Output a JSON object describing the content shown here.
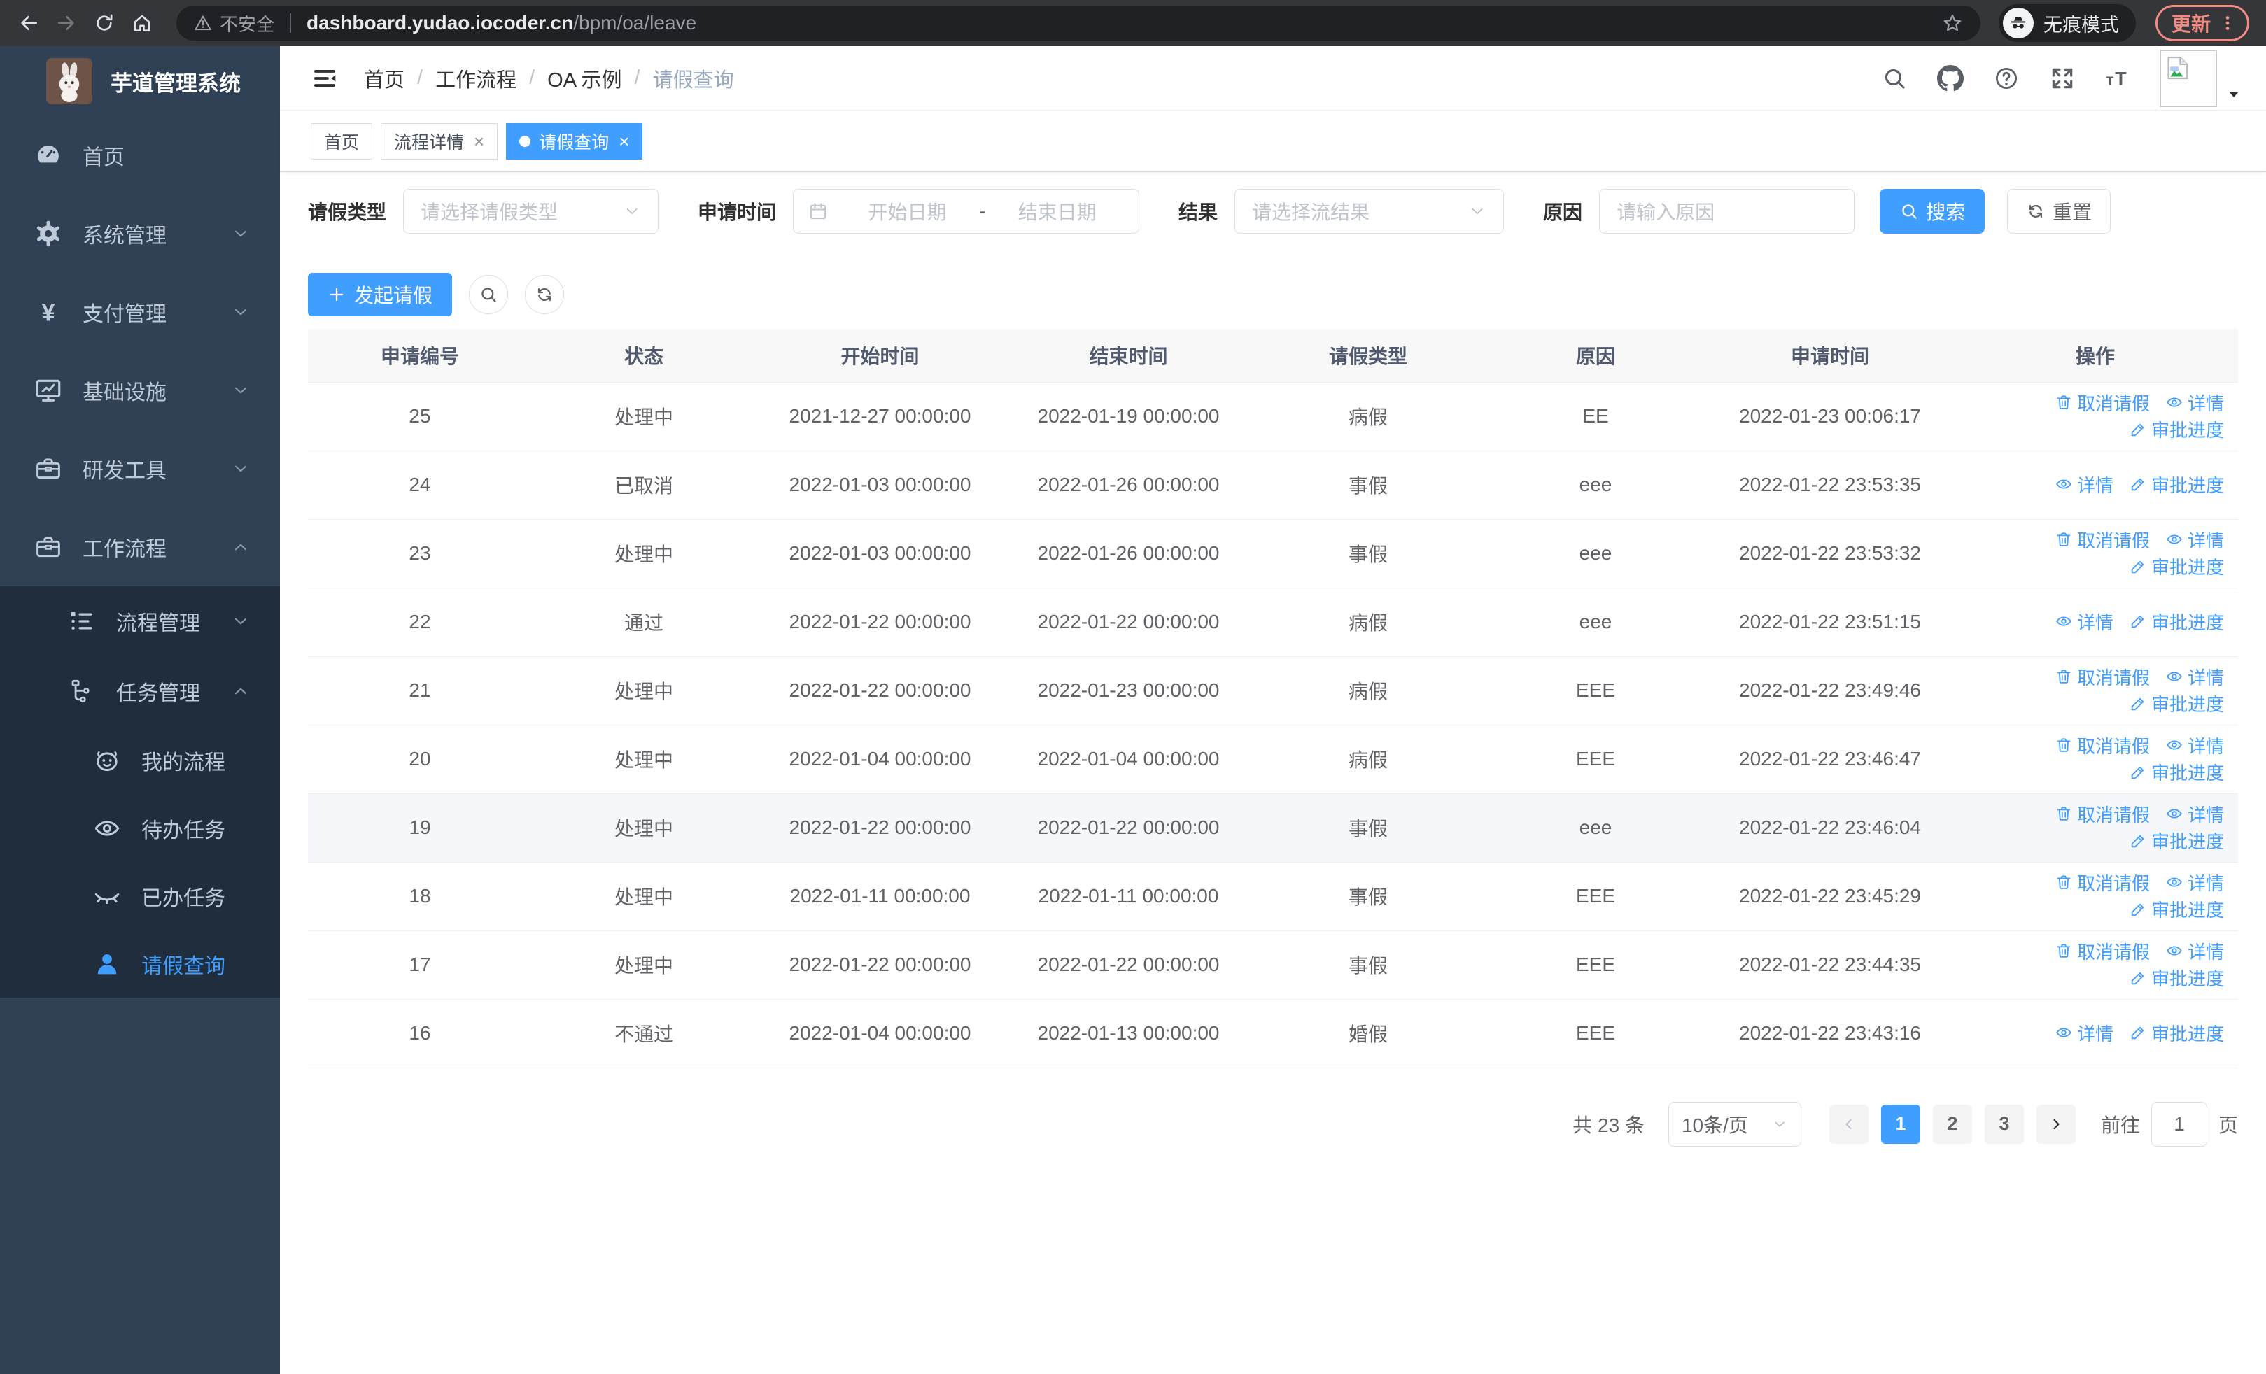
{
  "browser": {
    "security_label": "不安全",
    "url_host": "dashboard.yudao.iocoder.cn",
    "url_path": "/bpm/oa/leave",
    "incognito_label": "无痕模式",
    "update_label": "更新"
  },
  "sidebar": {
    "title": "芋道管理系统",
    "items": [
      {
        "name": "home",
        "label": "首页",
        "icon": "dashboard-icon",
        "expandable": false
      },
      {
        "name": "system",
        "label": "系统管理",
        "icon": "gear-icon",
        "expandable": true,
        "expanded": false
      },
      {
        "name": "pay",
        "label": "支付管理",
        "icon": "yen-icon",
        "expandable": true,
        "expanded": false
      },
      {
        "name": "infra",
        "label": "基础设施",
        "icon": "monitor-icon",
        "expandable": true,
        "expanded": false
      },
      {
        "name": "devtools",
        "label": "研发工具",
        "icon": "toolbox-icon",
        "expandable": true,
        "expanded": false
      },
      {
        "name": "workflow",
        "label": "工作流程",
        "icon": "briefcase-icon",
        "expandable": true,
        "expanded": true
      }
    ],
    "submenu": [
      {
        "name": "process-mgmt",
        "label": "流程管理",
        "icon": "list-icon",
        "level": 2,
        "expandable": true,
        "expanded": false
      },
      {
        "name": "task-mgmt",
        "label": "任务管理",
        "icon": "tree-icon",
        "level": 2,
        "expandable": true,
        "expanded": true
      },
      {
        "name": "my-process",
        "label": "我的流程",
        "icon": "face-icon",
        "level": 3
      },
      {
        "name": "todo-task",
        "label": "待办任务",
        "icon": "eye-icon",
        "level": 3
      },
      {
        "name": "done-task",
        "label": "已办任务",
        "icon": "eye-closed-icon",
        "level": 3
      },
      {
        "name": "leave-query",
        "label": "请假查询",
        "icon": "user-icon",
        "level": 3,
        "active": true
      }
    ]
  },
  "navbar": {
    "breadcrumb": [
      "首页",
      "工作流程",
      "OA 示例",
      "请假查询"
    ]
  },
  "tags_view": [
    {
      "label": "首页",
      "closable": false,
      "active": false
    },
    {
      "label": "流程详情",
      "closable": true,
      "active": false
    },
    {
      "label": "请假查询",
      "closable": true,
      "active": true
    }
  ],
  "filters": {
    "leave_type": {
      "label": "请假类型",
      "placeholder": "请选择请假类型"
    },
    "apply_time": {
      "label": "申请时间",
      "start_placeholder": "开始日期",
      "separator": "-",
      "end_placeholder": "结束日期"
    },
    "result": {
      "label": "结果",
      "placeholder": "请选择流结果"
    },
    "reason": {
      "label": "原因",
      "placeholder": "请输入原因"
    },
    "search_label": "搜索",
    "reset_label": "重置"
  },
  "toolbar": {
    "create_label": "发起请假"
  },
  "table": {
    "columns": [
      "申请编号",
      "状态",
      "开始时间",
      "结束时间",
      "请假类型",
      "原因",
      "申请时间",
      "操作"
    ],
    "action_labels": {
      "cancel": "取消请假",
      "detail": "详情",
      "progress": "审批进度"
    },
    "rows": [
      {
        "id": "25",
        "status": "处理中",
        "start": "2021-12-27 00:00:00",
        "end": "2022-01-19 00:00:00",
        "type": "病假",
        "reason": "EE",
        "applied": "2022-01-23 00:06:17",
        "actions": [
          "cancel",
          "detail",
          "progress"
        ],
        "highlight": false
      },
      {
        "id": "24",
        "status": "已取消",
        "start": "2022-01-03 00:00:00",
        "end": "2022-01-26 00:00:00",
        "type": "事假",
        "reason": "eee",
        "applied": "2022-01-22 23:53:35",
        "actions": [
          "detail",
          "progress"
        ],
        "highlight": false
      },
      {
        "id": "23",
        "status": "处理中",
        "start": "2022-01-03 00:00:00",
        "end": "2022-01-26 00:00:00",
        "type": "事假",
        "reason": "eee",
        "applied": "2022-01-22 23:53:32",
        "actions": [
          "cancel",
          "detail",
          "progress"
        ],
        "highlight": false
      },
      {
        "id": "22",
        "status": "通过",
        "start": "2022-01-22 00:00:00",
        "end": "2022-01-22 00:00:00",
        "type": "病假",
        "reason": "eee",
        "applied": "2022-01-22 23:51:15",
        "actions": [
          "detail",
          "progress"
        ],
        "highlight": false
      },
      {
        "id": "21",
        "status": "处理中",
        "start": "2022-01-22 00:00:00",
        "end": "2022-01-23 00:00:00",
        "type": "病假",
        "reason": "EEE",
        "applied": "2022-01-22 23:49:46",
        "actions": [
          "cancel",
          "detail",
          "progress"
        ],
        "highlight": false
      },
      {
        "id": "20",
        "status": "处理中",
        "start": "2022-01-04 00:00:00",
        "end": "2022-01-04 00:00:00",
        "type": "病假",
        "reason": "EEE",
        "applied": "2022-01-22 23:46:47",
        "actions": [
          "cancel",
          "detail",
          "progress"
        ],
        "highlight": false
      },
      {
        "id": "19",
        "status": "处理中",
        "start": "2022-01-22 00:00:00",
        "end": "2022-01-22 00:00:00",
        "type": "事假",
        "reason": "eee",
        "applied": "2022-01-22 23:46:04",
        "actions": [
          "cancel",
          "detail",
          "progress"
        ],
        "highlight": true
      },
      {
        "id": "18",
        "status": "处理中",
        "start": "2022-01-11 00:00:00",
        "end": "2022-01-11 00:00:00",
        "type": "事假",
        "reason": "EEE",
        "applied": "2022-01-22 23:45:29",
        "actions": [
          "cancel",
          "detail",
          "progress"
        ],
        "highlight": false
      },
      {
        "id": "17",
        "status": "处理中",
        "start": "2022-01-22 00:00:00",
        "end": "2022-01-22 00:00:00",
        "type": "事假",
        "reason": "EEE",
        "applied": "2022-01-22 23:44:35",
        "actions": [
          "cancel",
          "detail",
          "progress"
        ],
        "highlight": false
      },
      {
        "id": "16",
        "status": "不通过",
        "start": "2022-01-04 00:00:00",
        "end": "2022-01-13 00:00:00",
        "type": "婚假",
        "reason": "EEE",
        "applied": "2022-01-22 23:43:16",
        "actions": [
          "detail",
          "progress"
        ],
        "highlight": false
      }
    ]
  },
  "pagination": {
    "total_label": "共 23 条",
    "page_size_label": "10条/页",
    "pages": [
      "1",
      "2",
      "3"
    ],
    "active_page": "1",
    "goto_label": "前往",
    "goto_value": "1",
    "goto_suffix": "页"
  },
  "colors": {
    "primary": "#409eff",
    "sidebar_bg": "#304156",
    "submenu_bg": "#1f2d3d",
    "update_accent": "#f28b82"
  }
}
